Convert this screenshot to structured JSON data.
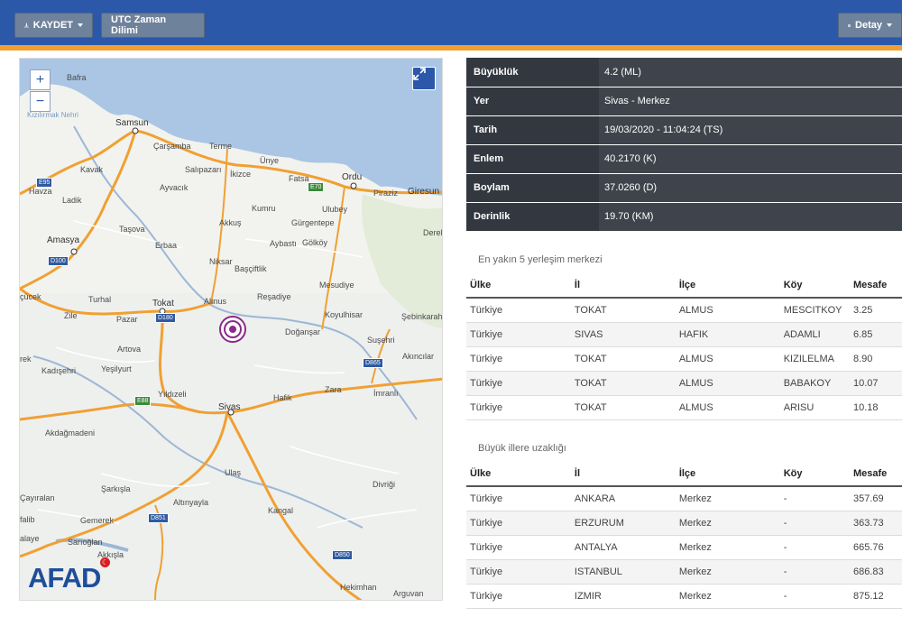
{
  "toolbar": {
    "save_label": "KAYDET",
    "timezone_label": "UTC Zaman Dilimi",
    "detail_label": "Detay"
  },
  "map": {
    "zoom_in": "+",
    "zoom_out": "−",
    "logo": "AFAD",
    "labels": {
      "samsun": "Samsun",
      "bafra": "Bafra",
      "kizilirmak": "Kızılırmak Nehri",
      "carsamba": "Çarşamba",
      "terme": "Terme",
      "unye": "Ünye",
      "ordu": "Ordu",
      "fatsa": "Fatsa",
      "piraziz": "Piraziz",
      "giresun": "Giresun",
      "kavak": "Kavak",
      "salipazari": "Salıpazarı",
      "ikizce": "İkizce",
      "havza": "Havza",
      "ladik": "Ladik",
      "ayvacik": "Ayvacık",
      "kumru": "Kumru",
      "ulubey": "Ulubey",
      "akkus": "Akkuş",
      "gurgentepe": "Gürgentepe",
      "tasova": "Taşova",
      "erbaa": "Erbaa",
      "aybasti": "Aybastı",
      "golkoy": "Gölköy",
      "dereli": "Dereli",
      "amasya": "Amasya",
      "niksar": "Niksar",
      "bascifflik": "Başçiftlik",
      "mesudiye": "Mesudiye",
      "cicek": "çücek",
      "turhal": "Turhal",
      "tokat": "Tokat",
      "almus": "Almus",
      "resadiye": "Reşadiye",
      "koyulhisar": "Koyulhisar",
      "sebinkarahisar": "Şebinkarah",
      "zile": "Zile",
      "pazar": "Pazar",
      "dogansar": "Doğanşar",
      "susehri": "Suşehri",
      "artova": "Artova",
      "akincilar": "Akıncılar",
      "kadisehri": "Kadışehri",
      "yesilyurt": "Yeşilyurt",
      "yildizeli": "Yıldızeli",
      "hafik": "Hafik",
      "zara": "Zara",
      "imranli": "İmranlı",
      "sivas": "Sivas",
      "akdagmadeni": "Akdağmadeni",
      "ulas": "Ulaş",
      "sarkisla": "Şarkışla",
      "altinyayla": "Altınyayla",
      "divrigi": "Divriği",
      "cayiralan": "Çayıralan",
      "kangal": "Kangal",
      "gemerek": "Gemerek",
      "saraoglan": "Sarıoğlan",
      "akkisla": "Akkışla",
      "hekimhan": "Hekimhan",
      "arguvan": "Arguvan",
      "afalaye": "alaye",
      "afalib": "falib",
      "rek": "rek"
    },
    "roads": {
      "e95": "E95",
      "e70": "E70",
      "d100": "D100",
      "d180": "D180",
      "e88": "E88",
      "d865": "D865",
      "d851": "D851",
      "d850": "D850"
    }
  },
  "details": [
    {
      "key": "Büyüklük",
      "value": "4.2 (ML)"
    },
    {
      "key": "Yer",
      "value": "Sivas - Merkez"
    },
    {
      "key": "Tarih",
      "value": "19/03/2020 - 11:04:24 (TS)"
    },
    {
      "key": "Enlem",
      "value": "40.2170 (K)"
    },
    {
      "key": "Boylam",
      "value": "37.0260 (D)"
    },
    {
      "key": "Derinlik",
      "value": "19.70 (KM)"
    }
  ],
  "nearest": {
    "caption": "En yakın 5 yerleşim merkezi",
    "headers": [
      "Ülke",
      "İl",
      "İlçe",
      "Köy",
      "Mesafe"
    ],
    "rows": [
      [
        "Türkiye",
        "TOKAT",
        "ALMUS",
        "MESCITKOY",
        "3.25"
      ],
      [
        "Türkiye",
        "SIVAS",
        "HAFIK",
        "ADAMLI",
        "6.85"
      ],
      [
        "Türkiye",
        "TOKAT",
        "ALMUS",
        "KIZILELMA",
        "8.90"
      ],
      [
        "Türkiye",
        "TOKAT",
        "ALMUS",
        "BABAKOY",
        "10.07"
      ],
      [
        "Türkiye",
        "TOKAT",
        "ALMUS",
        "ARISU",
        "10.18"
      ]
    ]
  },
  "cities": {
    "caption": "Büyük illere uzaklığı",
    "headers": [
      "Ülke",
      "İl",
      "İlçe",
      "Köy",
      "Mesafe"
    ],
    "rows": [
      [
        "Türkiye",
        "ANKARA",
        "Merkez",
        "-",
        "357.69"
      ],
      [
        "Türkiye",
        "ERZURUM",
        "Merkez",
        "-",
        "363.73"
      ],
      [
        "Türkiye",
        "ANTALYA",
        "Merkez",
        "-",
        "665.76"
      ],
      [
        "Türkiye",
        "ISTANBUL",
        "Merkez",
        "-",
        "686.83"
      ],
      [
        "Türkiye",
        "IZMIR",
        "Merkez",
        "-",
        "875.12"
      ]
    ]
  },
  "colors": {
    "header": "#2b58a8",
    "header_border": "#f0a030",
    "epicenter": "#8a2a8a"
  }
}
